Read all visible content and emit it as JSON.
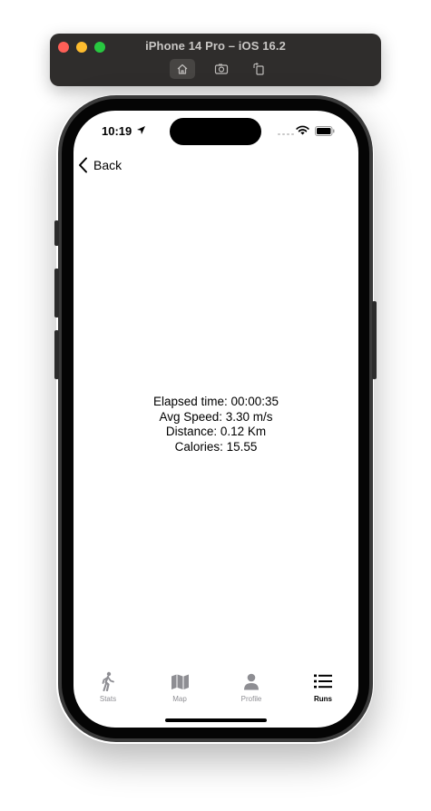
{
  "simulator": {
    "title": "iPhone 14 Pro – iOS 16.2",
    "toolbar": [
      "home-icon",
      "screenshot-icon",
      "rotate-icon"
    ]
  },
  "status_bar": {
    "time": "10:19"
  },
  "nav": {
    "back_label": "Back"
  },
  "stats": {
    "elapsed": "Elapsed time: 00:00:35",
    "avg_speed": "Avg Speed: 3.30 m/s",
    "distance": "Distance: 0.12 Km",
    "calories": "Calories: 15.55"
  },
  "tab_bar": {
    "items": [
      {
        "label": "Stats",
        "icon": "walk-icon",
        "active": false
      },
      {
        "label": "Map",
        "icon": "map-icon",
        "active": false
      },
      {
        "label": "Profile",
        "icon": "person-icon",
        "active": false
      },
      {
        "label": "Runs",
        "icon": "list-icon",
        "active": true
      }
    ]
  },
  "colors": {
    "active_tab": "#000000",
    "inactive_tab": "#8e8e93",
    "titlebar": "#2f2d2c"
  }
}
